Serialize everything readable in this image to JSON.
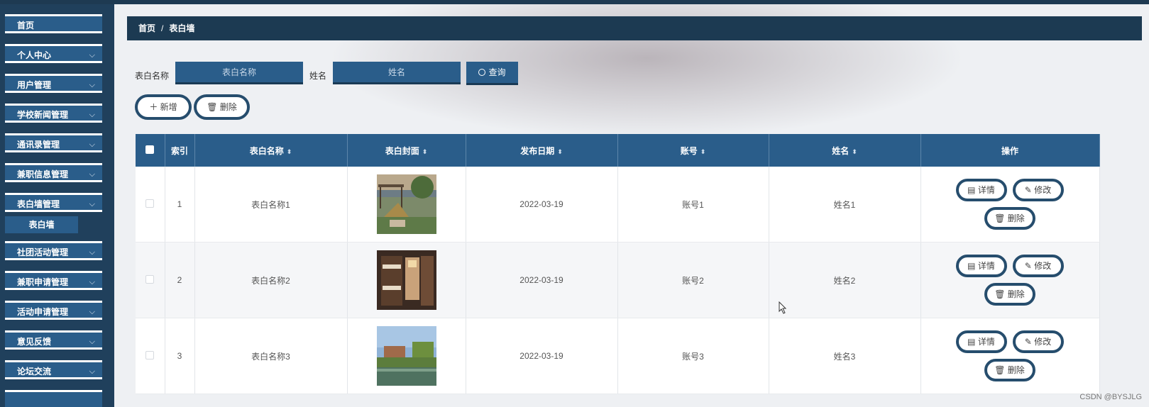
{
  "sidebar": {
    "items": [
      {
        "label": "首页",
        "has_arrow": false
      },
      {
        "label": "个人中心",
        "has_arrow": true
      },
      {
        "label": "用户管理",
        "has_arrow": true
      },
      {
        "label": "学校新闻管理",
        "has_arrow": true
      },
      {
        "label": "通讯录管理",
        "has_arrow": true
      },
      {
        "label": "兼职信息管理",
        "has_arrow": true
      },
      {
        "label": "表白墙管理",
        "has_arrow": true
      },
      {
        "label": "社团活动管理",
        "has_arrow": true
      },
      {
        "label": "兼职申请管理",
        "has_arrow": true
      },
      {
        "label": "活动申请管理",
        "has_arrow": true
      },
      {
        "label": "意见反馈",
        "has_arrow": true
      },
      {
        "label": "论坛交流",
        "has_arrow": true
      }
    ],
    "submenu": {
      "label": "表白墙"
    },
    "arrow_glyph": "⌵"
  },
  "breadcrumb": {
    "home": "首页",
    "separator": "/",
    "current": "表白墙"
  },
  "search": {
    "name_label": "表白名称",
    "name_placeholder": "表白名称",
    "person_label": "姓名",
    "person_placeholder": "姓名",
    "query_label": "查询",
    "query_icon": "search-icon"
  },
  "actions": {
    "add_label": "新增",
    "delete_label": "删除"
  },
  "table": {
    "headers": [
      "",
      "索引",
      "表白名称",
      "表白封面",
      "发布日期",
      "账号",
      "姓名",
      "操作"
    ],
    "sortable": [
      false,
      false,
      true,
      true,
      true,
      true,
      true,
      false
    ],
    "rows": [
      {
        "index": "1",
        "name": "表白名称1",
        "cover": "garden-pavilion-image",
        "date": "2022-03-19",
        "account": "账号1",
        "person": "姓名1"
      },
      {
        "index": "2",
        "name": "表白名称2",
        "cover": "dormitory-bunk-image",
        "date": "2022-03-19",
        "account": "账号2",
        "person": "姓名2"
      },
      {
        "index": "3",
        "name": "表白名称3",
        "cover": "campus-lake-image",
        "date": "2022-03-19",
        "account": "账号3",
        "person": "姓名3"
      }
    ],
    "row_actions": {
      "detail": "详情",
      "edit": "修改",
      "delete": "删除"
    }
  },
  "watermark": "CSDN @BYSJLG",
  "colors": {
    "sidebar_bg": "#20405c",
    "button_blue": "#2a5d8a",
    "breadcrumb_bg": "#1c3a52",
    "pill_border": "#264d6d"
  }
}
